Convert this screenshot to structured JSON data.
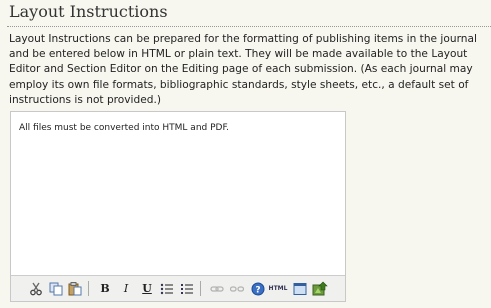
{
  "section": {
    "title": "Layout Instructions",
    "description": "Layout Instructions can be prepared for the formatting of publishing items in the journal and be entered below in HTML or plain text. They will be made available to the Layout Editor and Section Editor on the Editing page of each submission. (As each journal may employ its own file formats, bibliographic standards, style sheets, etc., a default set of instructions is not provided.)"
  },
  "editor": {
    "content": "All files must be converted into HTML and PDF.",
    "toolbar": [
      {
        "name": "cut",
        "icon": "scissors-icon"
      },
      {
        "name": "copy",
        "icon": "copy-icon"
      },
      {
        "name": "paste",
        "icon": "paste-icon"
      },
      {
        "name": "bold",
        "label": "B"
      },
      {
        "name": "italic",
        "label": "I"
      },
      {
        "name": "underline",
        "label": "U"
      },
      {
        "name": "bullet-list",
        "icon": "bullet-list-icon"
      },
      {
        "name": "numbered-list",
        "icon": "numbered-list-icon"
      },
      {
        "name": "link",
        "icon": "link-icon"
      },
      {
        "name": "unlink",
        "icon": "unlink-icon"
      },
      {
        "name": "help",
        "icon": "help-icon"
      },
      {
        "name": "html",
        "label": "HTML"
      },
      {
        "name": "fullscreen",
        "icon": "fullscreen-icon"
      },
      {
        "name": "image",
        "icon": "image-upload-icon"
      }
    ]
  }
}
